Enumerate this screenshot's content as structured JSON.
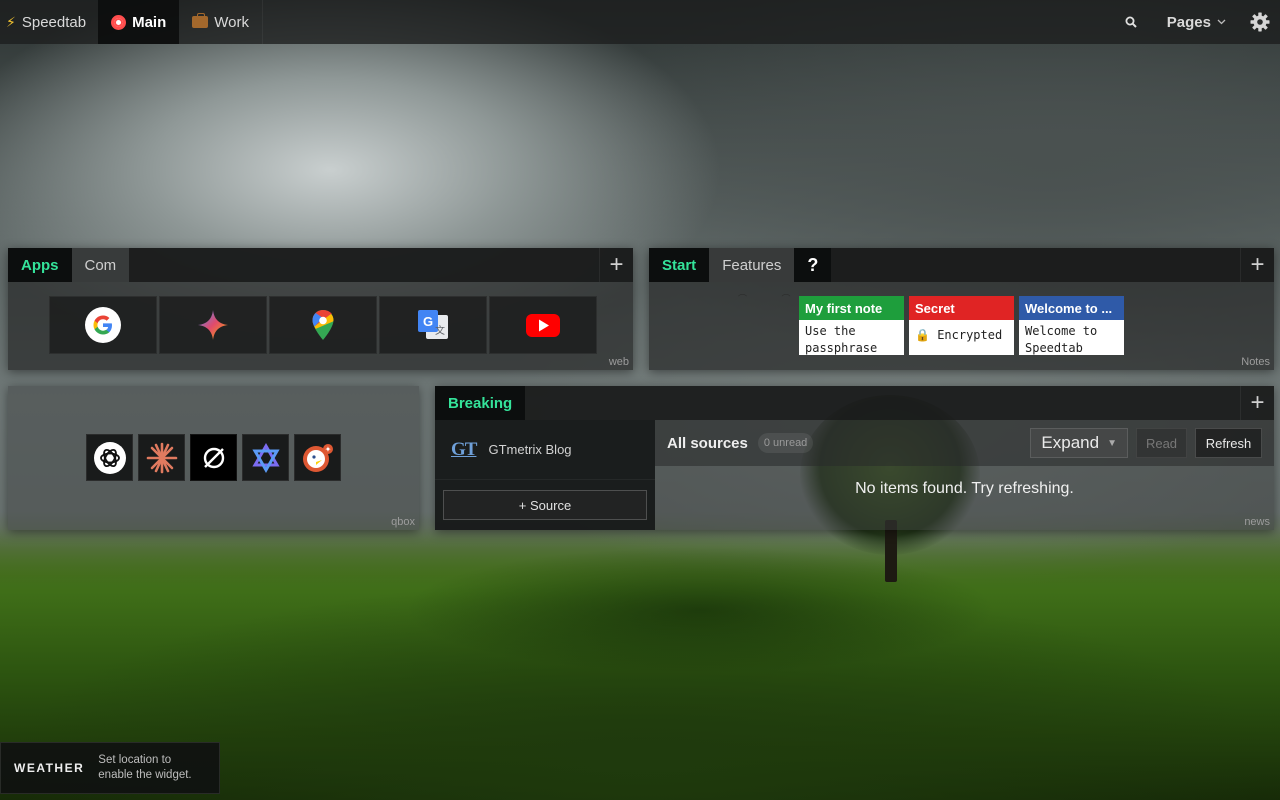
{
  "topbar": {
    "brand": "Speedtab",
    "tabs": [
      {
        "label": "Main",
        "active": true
      },
      {
        "label": "Work",
        "active": false
      }
    ],
    "pages_label": "Pages"
  },
  "apps_widget": {
    "tabs": [
      {
        "label": "Apps",
        "active": true
      },
      {
        "label": "Com",
        "active": false
      }
    ],
    "footer": "web",
    "apps": [
      {
        "name": "google-icon"
      },
      {
        "name": "gemini-icon"
      },
      {
        "name": "google-maps-icon"
      },
      {
        "name": "google-translate-icon"
      },
      {
        "name": "youtube-icon"
      }
    ]
  },
  "notes_widget": {
    "tabs": [
      {
        "label": "Start",
        "active": true
      },
      {
        "label": "Features",
        "active": false
      },
      {
        "label": "?",
        "active": false
      }
    ],
    "footer": "Notes",
    "notes": [
      {
        "title": "My first note",
        "body": "Use the passphrase",
        "color": "#1e9e3c"
      },
      {
        "title": "Secret",
        "body": "Encrypted",
        "color": "#e02424",
        "locked": true
      },
      {
        "title": "Welcome to ...",
        "body": "Welcome to Speedtab",
        "color": "#2f5aa8"
      }
    ]
  },
  "qbox_widget": {
    "footer": "qbox",
    "items": [
      {
        "name": "chatgpt-icon"
      },
      {
        "name": "claude-icon"
      },
      {
        "name": "perplexity-icon"
      },
      {
        "name": "cursor-star-icon"
      },
      {
        "name": "duckduckgo-ai-icon"
      }
    ]
  },
  "news_widget": {
    "tabs": [
      {
        "label": "Breaking",
        "active": true
      }
    ],
    "footer": "news",
    "sources": [
      {
        "label": "GTmetrix Blog",
        "logo": "GT"
      }
    ],
    "add_source_label": "+ Source",
    "all_sources_label": "All sources",
    "unread_label": "0 unread",
    "expand_label": "Expand",
    "read_label": "Read",
    "refresh_label": "Refresh",
    "empty_message": "No items found. Try refreshing."
  },
  "weather_widget": {
    "title": "WEATHER",
    "message": "Set location to enable the widget."
  },
  "colors": {
    "accent": "#34e39a",
    "note_green": "#1e9e3c",
    "note_red": "#e02424",
    "note_blue": "#2f5aa8"
  }
}
